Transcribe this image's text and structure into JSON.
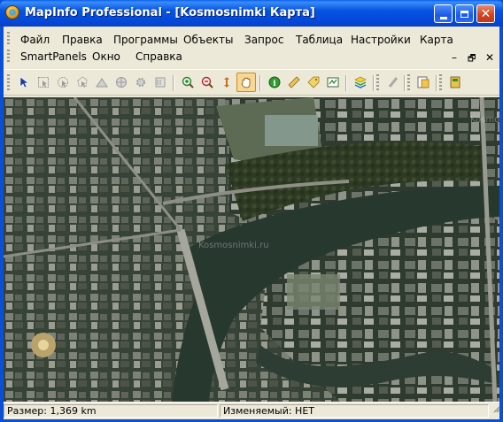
{
  "window": {
    "title": "MapInfo Professional - [Kosmosnimki Карта]",
    "controls": [
      "minimize",
      "maximize",
      "close"
    ]
  },
  "menu": {
    "row1": [
      "Файл",
      "Правка",
      "Программы",
      "Объекты",
      "Запрос",
      "Таблица",
      "Настройки",
      "Карта"
    ],
    "row2": [
      "SmartPanels",
      "Окно",
      "Справка"
    ]
  },
  "toolbar": {
    "tools": [
      "select-arrow-icon",
      "marquee-select-icon",
      "radius-select-icon",
      "polygon-select-icon",
      "boundary-select-icon",
      "globe-icon",
      "gear-icon",
      "graph-select-icon",
      "zoom-in-icon",
      "zoom-out-icon",
      "hand-pan-icon",
      "info-icon",
      "label-tag-icon",
      "map-window-icon",
      "layers-icon",
      "ruler-icon",
      "browser-icon",
      "legend-book-icon"
    ],
    "active_tool": "hand-pan-icon"
  },
  "map": {
    "watermarks": [
      "Kosmosnimki.ru",
      "Kosmo"
    ]
  },
  "status": {
    "size": "Размер: 1,369 km",
    "editable": "Изменяемый: НЕТ"
  }
}
